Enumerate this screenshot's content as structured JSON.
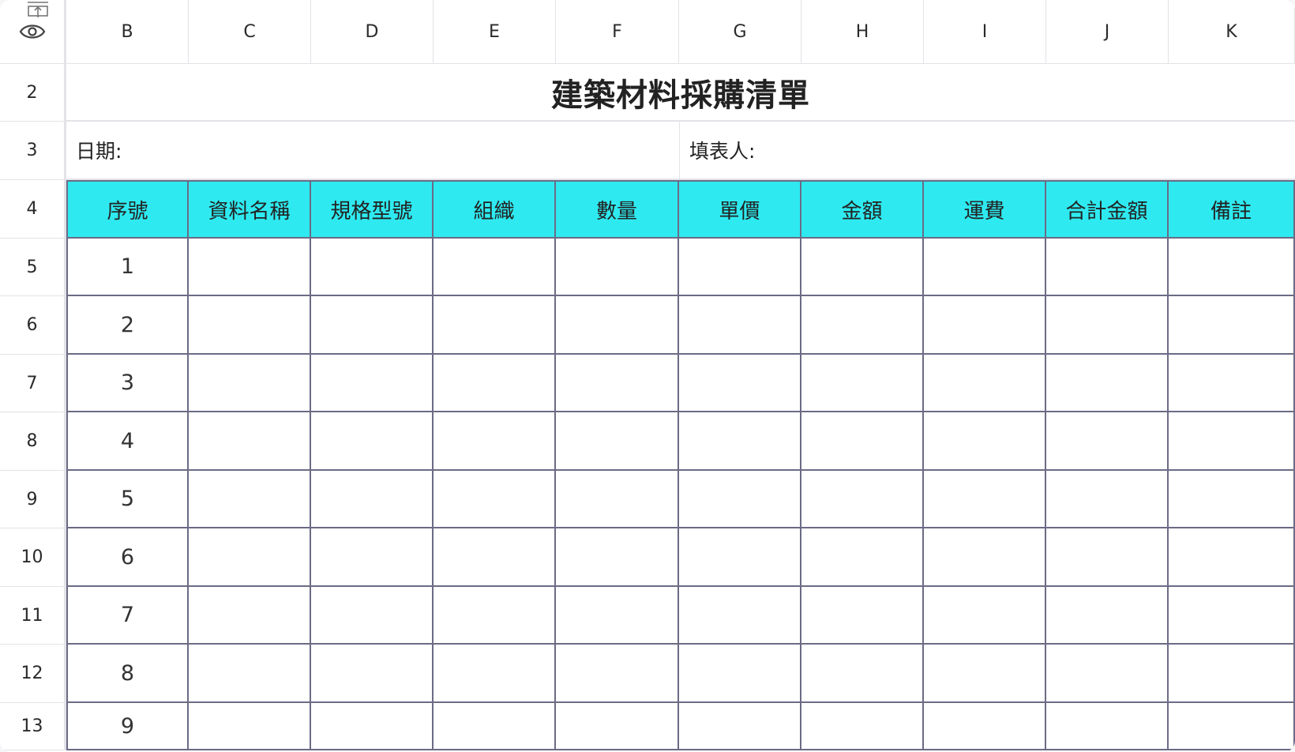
{
  "columns": [
    "B",
    "C",
    "D",
    "E",
    "F",
    "G",
    "H",
    "I",
    "J",
    "K"
  ],
  "rows": [
    "2",
    "3",
    "4",
    "5",
    "6",
    "7",
    "8",
    "9",
    "10",
    "11",
    "12",
    "13"
  ],
  "title": "建築材料採購清單",
  "date_label": "日期:",
  "preparer_label": "填表人:",
  "headers": [
    "序號",
    "資料名稱",
    "規格型號",
    "組織",
    "數量",
    "單價",
    "金額",
    "運費",
    "合計金額",
    "備註"
  ],
  "serials": [
    "1",
    "2",
    "3",
    "4",
    "5",
    "6",
    "7",
    "8",
    "9"
  ],
  "colors": {
    "header_bg": "#2eeaf0",
    "grid_line": "#6b6b86"
  },
  "icons": {
    "corner_top": "freeze-top-icon",
    "corner_eye": "eye-icon"
  }
}
